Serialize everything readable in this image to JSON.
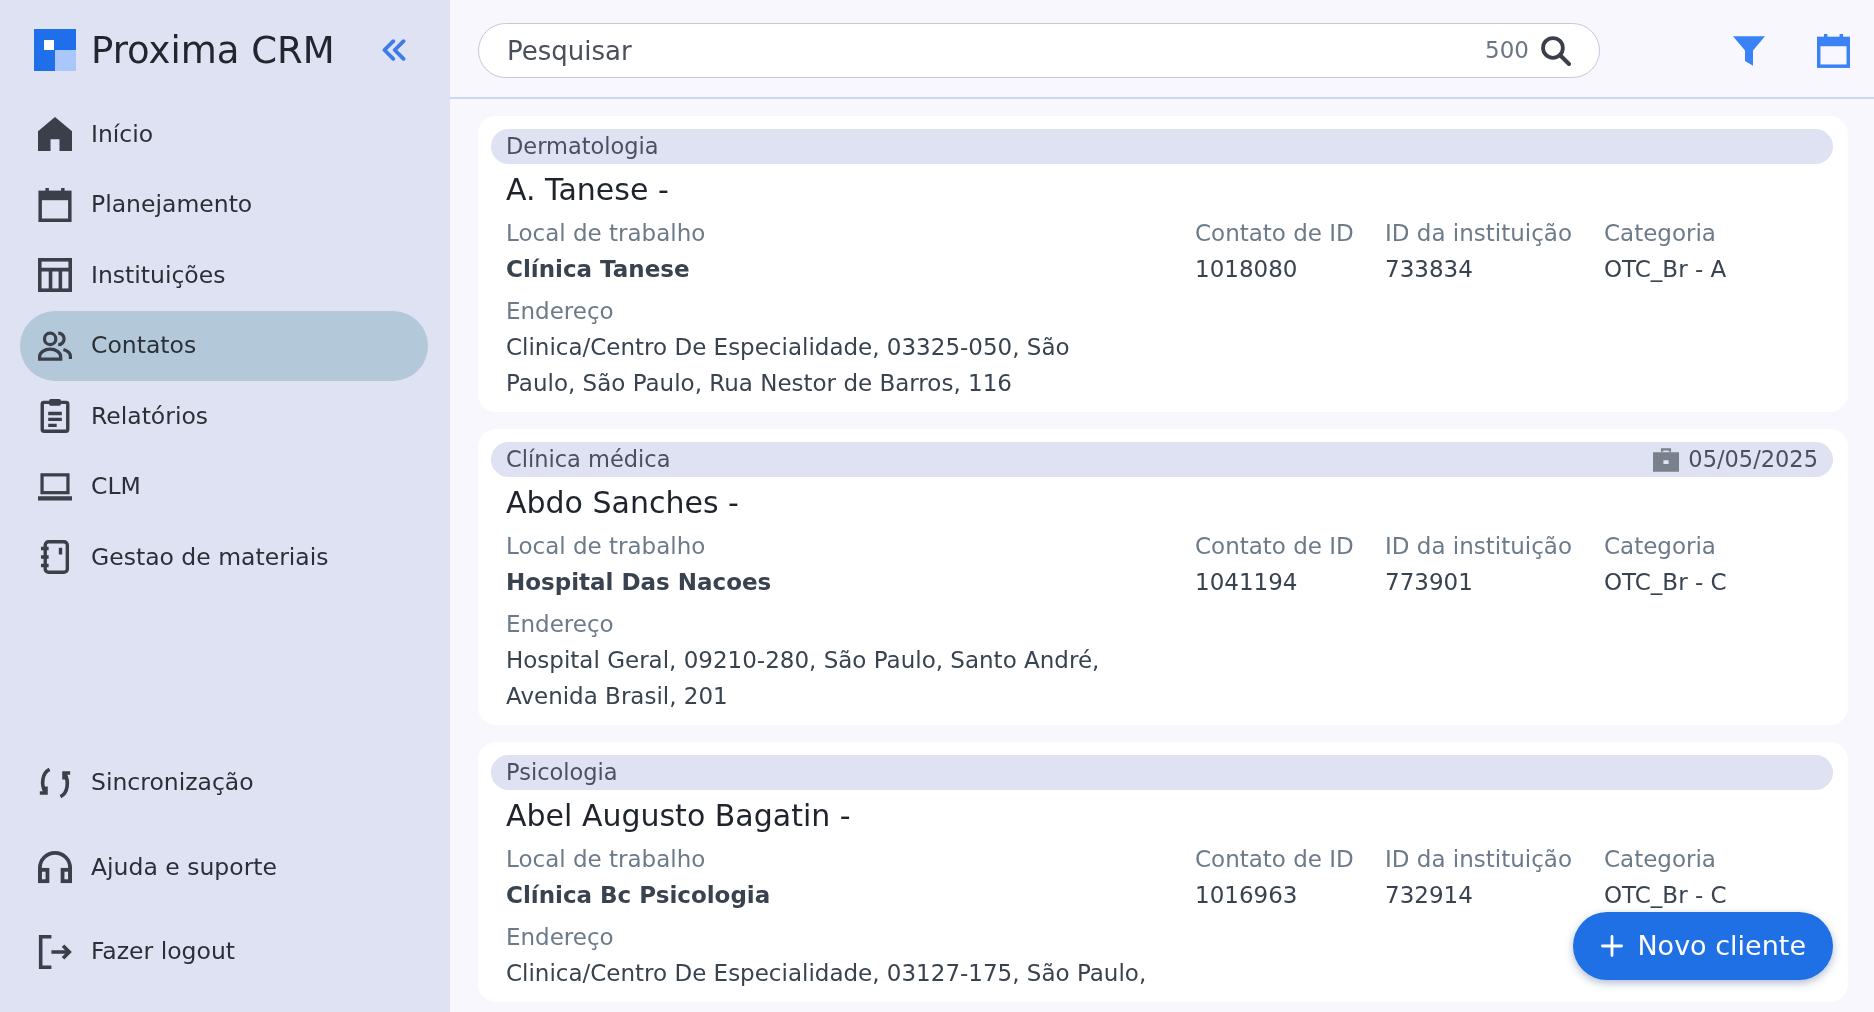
{
  "sidebar": {
    "app_name": "Proxima CRM",
    "nav_items": [
      {
        "label": "Início",
        "selected": false
      },
      {
        "label": "Planejamento",
        "selected": false
      },
      {
        "label": "Instituições",
        "selected": false
      },
      {
        "label": "Contatos",
        "selected": true
      },
      {
        "label": "Relatórios",
        "selected": false
      },
      {
        "label": "CLM",
        "selected": false
      },
      {
        "label": "Gestao de materiais",
        "selected": false
      }
    ],
    "footer_items": [
      {
        "label": "Sincronização"
      },
      {
        "label": "Ajuda e suporte"
      },
      {
        "label": "Fazer logout"
      }
    ]
  },
  "search": {
    "placeholder": "Pesquisar",
    "result_count": "500"
  },
  "contacts": [
    {
      "specialty": "Dermatologia",
      "name": "A. Tanese -",
      "workplace": {
        "label": "Local de trabalho",
        "value": "Clínica Tanese"
      },
      "fields": [
        {
          "label": "Contato de ID",
          "value": "1018080"
        },
        {
          "label": "ID da instituição",
          "value": "733834"
        },
        {
          "label": "Categoria",
          "value": "OTC_Br - A"
        }
      ],
      "address": {
        "label": "Endereço",
        "lines": [
          "Clinica/Centro De Especialidade, 03325-050, São",
          "Paulo, São Paulo, Rua Nestor de Barros, 116"
        ]
      }
    },
    {
      "specialty": "Clínica médica",
      "date": "05/05/2025",
      "name": "Abdo Sanches -",
      "workplace": {
        "label": "Local de trabalho",
        "value": "Hospital Das Nacoes"
      },
      "fields": [
        {
          "label": "Contato de ID",
          "value": "1041194"
        },
        {
          "label": "ID da instituição",
          "value": "773901"
        },
        {
          "label": "Categoria",
          "value": "OTC_Br - C"
        }
      ],
      "address": {
        "label": "Endereço",
        "lines": [
          "Hospital Geral, 09210-280, São Paulo, Santo André,",
          "Avenida Brasil, 201"
        ]
      }
    },
    {
      "specialty": "Psicologia",
      "name": "Abel Augusto Bagatin -",
      "workplace": {
        "label": "Local de trabalho",
        "value": "Clínica Bc Psicologia"
      },
      "fields": [
        {
          "label": "Contato de ID",
          "value": "1016963"
        },
        {
          "label": "ID da instituição",
          "value": "732914"
        },
        {
          "label": "Categoria",
          "value": "OTC_Br - C"
        }
      ],
      "address": {
        "label": "Endereço",
        "lines": [
          "Clinica/Centro De Especialidade, 03127-175, São Paulo,"
        ]
      }
    }
  ],
  "new_client_button": {
    "label": "Novo cliente"
  }
}
